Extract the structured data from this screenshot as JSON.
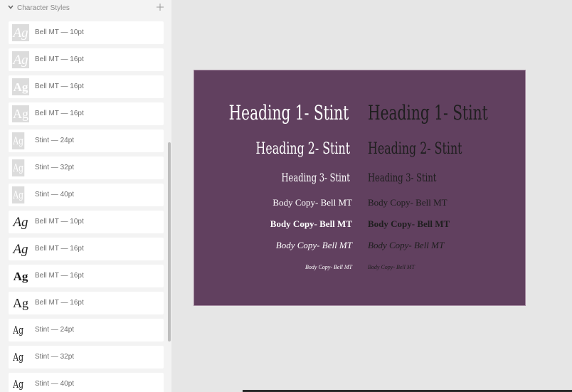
{
  "panel": {
    "section_title": "Character Styles",
    "items": [
      {
        "thumb": "Ag",
        "label": "Bell MT — 10pt",
        "style": "italic",
        "fill": "gray"
      },
      {
        "thumb": "Ag",
        "label": "Bell MT — 16pt",
        "style": "italic",
        "fill": "gray"
      },
      {
        "thumb": "Ag",
        "label": "Bell MT — 16pt",
        "style": "bold",
        "fill": "gray"
      },
      {
        "thumb": "Ag",
        "label": "Bell MT — 16pt",
        "style": "regular",
        "fill": "gray"
      },
      {
        "thumb": "Ag",
        "label": "Stint — 24pt",
        "style": "stint",
        "fill": "gray"
      },
      {
        "thumb": "Ag",
        "label": "Stint — 32pt",
        "style": "stint",
        "fill": "gray"
      },
      {
        "thumb": "Ag",
        "label": "Stint — 40pt",
        "style": "stint",
        "fill": "gray"
      },
      {
        "thumb": "Ag",
        "label": "Bell MT — 10pt",
        "style": "italic",
        "fill": "clear"
      },
      {
        "thumb": "Ag",
        "label": "Bell MT — 16pt",
        "style": "italic",
        "fill": "clear"
      },
      {
        "thumb": "Ag",
        "label": "Bell MT — 16pt",
        "style": "bold",
        "fill": "clear"
      },
      {
        "thumb": "Ag",
        "label": "Bell MT — 16pt",
        "style": "regular",
        "fill": "clear"
      },
      {
        "thumb": "Ag",
        "label": "Stint — 24pt",
        "style": "stint",
        "fill": "clear"
      },
      {
        "thumb": "Ag",
        "label": "Stint — 32pt",
        "style": "stint",
        "fill": "clear"
      },
      {
        "thumb": "Ag",
        "label": "Stint — 40pt",
        "style": "stint",
        "fill": "clear"
      }
    ]
  },
  "artboard": {
    "background": "#61405f",
    "light_text": "#ffffff",
    "dark_text": "#1e1e1e",
    "h1": "Heading 1- Stint",
    "h2": "Heading 2- Stint",
    "h3": "Heading 3- Stint",
    "body": "Body Copy- Bell MT",
    "body_bold": "Body Copy- Bell MT",
    "body_italic": "Body Copy- Bell MT",
    "body_small": "Body Copy- Bell MT"
  },
  "icons": {
    "chevron": "chevron-down-icon",
    "add": "plus-icon"
  }
}
